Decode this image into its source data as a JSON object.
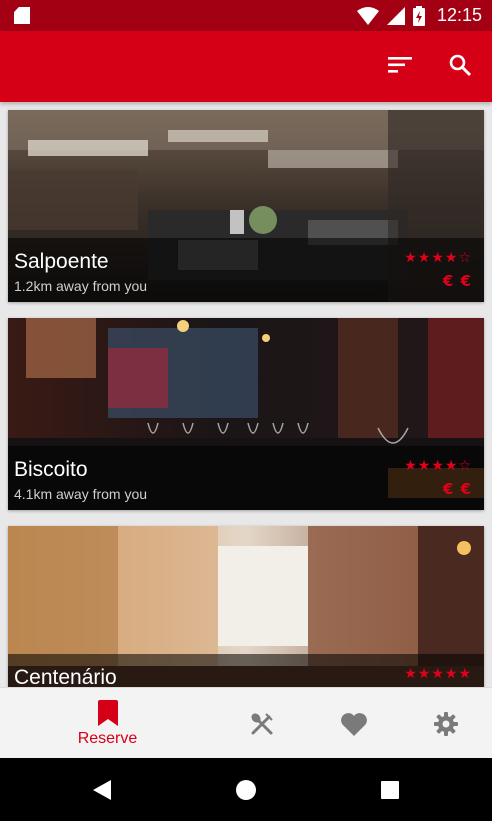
{
  "status_bar": {
    "time": "12:15",
    "icons": [
      "sd-card-icon",
      "wifi-icon",
      "signal-icon",
      "battery-charging-icon"
    ]
  },
  "app_bar": {
    "actions": [
      "filter-icon",
      "search-icon"
    ],
    "color": "#d50016"
  },
  "restaurants": [
    {
      "name": "Salpoente",
      "distance": "1.2km away from you",
      "rating": 4,
      "rating_max": 5,
      "price": "€ €"
    },
    {
      "name": "Biscoito",
      "distance": "4.1km away from you",
      "rating": 4,
      "rating_max": 5,
      "price": "€ €"
    },
    {
      "name": "Centenário",
      "distance": "",
      "rating": 5,
      "rating_max": 5,
      "price": ""
    }
  ],
  "bottom_nav": {
    "active_index": 0,
    "items": [
      {
        "icon": "bookmark-icon",
        "label": "Reserve"
      },
      {
        "icon": "cutlery-icon",
        "label": ""
      },
      {
        "icon": "heart-icon",
        "label": ""
      },
      {
        "icon": "gear-icon",
        "label": ""
      }
    ]
  },
  "system_nav": [
    "back-icon",
    "home-icon",
    "recents-icon"
  ],
  "colors": {
    "accent": "#e3001b",
    "status_bar": "#a30014"
  }
}
